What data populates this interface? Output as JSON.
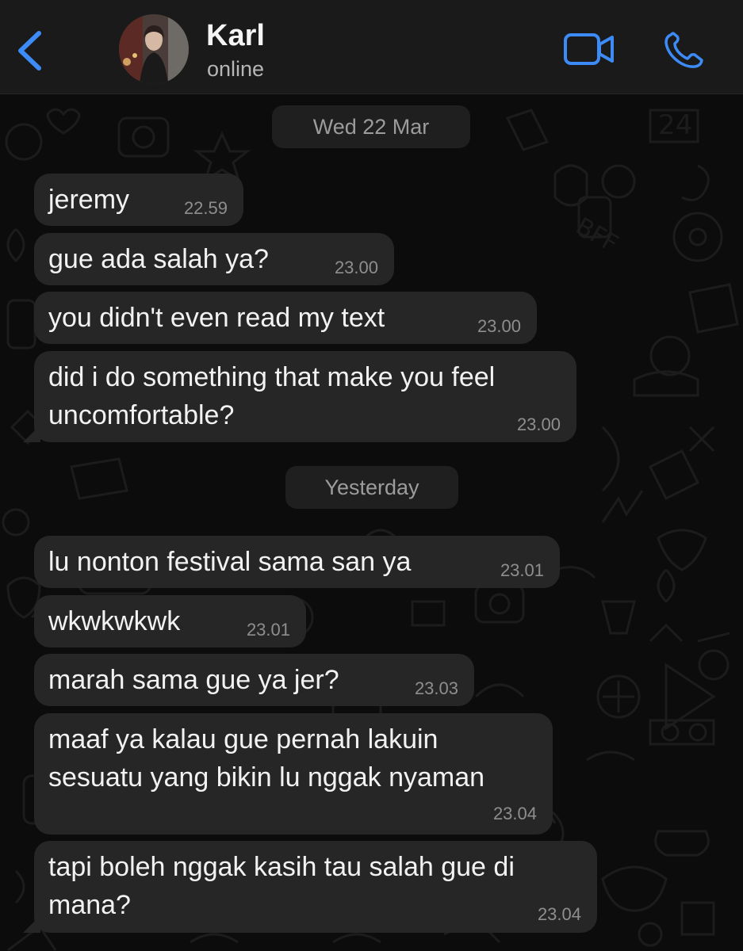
{
  "header": {
    "back_icon": "chevron-left-icon",
    "contact_name": "Karl",
    "status": "online",
    "video_icon": "video-camera-icon",
    "call_icon": "phone-icon",
    "accent_color": "#3d8bf7"
  },
  "chat": {
    "date_separators": [
      "Wed 22 Mar",
      "Yesterday"
    ],
    "messages": [
      {
        "text": "jeremy",
        "time": "22.59"
      },
      {
        "text": "gue ada salah ya?",
        "time": "23.00"
      },
      {
        "text": "you didn't even read my text",
        "time": "23.00"
      },
      {
        "text_lines": [
          "did i do something that make you feel",
          "uncomfortable?"
        ],
        "time": "23.00"
      },
      {
        "text": "lu nonton festival sama san ya",
        "time": "23.01"
      },
      {
        "text": "wkwkwkwk",
        "time": "23.01"
      },
      {
        "text": "marah sama gue ya jer?",
        "time": "23.03"
      },
      {
        "text_lines": [
          "maaf ya kalau gue pernah lakuin",
          "sesuatu yang bikin lu nggak nyaman"
        ],
        "time": "23.04"
      },
      {
        "text_lines": [
          "tapi boleh nggak kasih tau salah gue di",
          "mana?"
        ],
        "time": "23.04"
      }
    ]
  }
}
